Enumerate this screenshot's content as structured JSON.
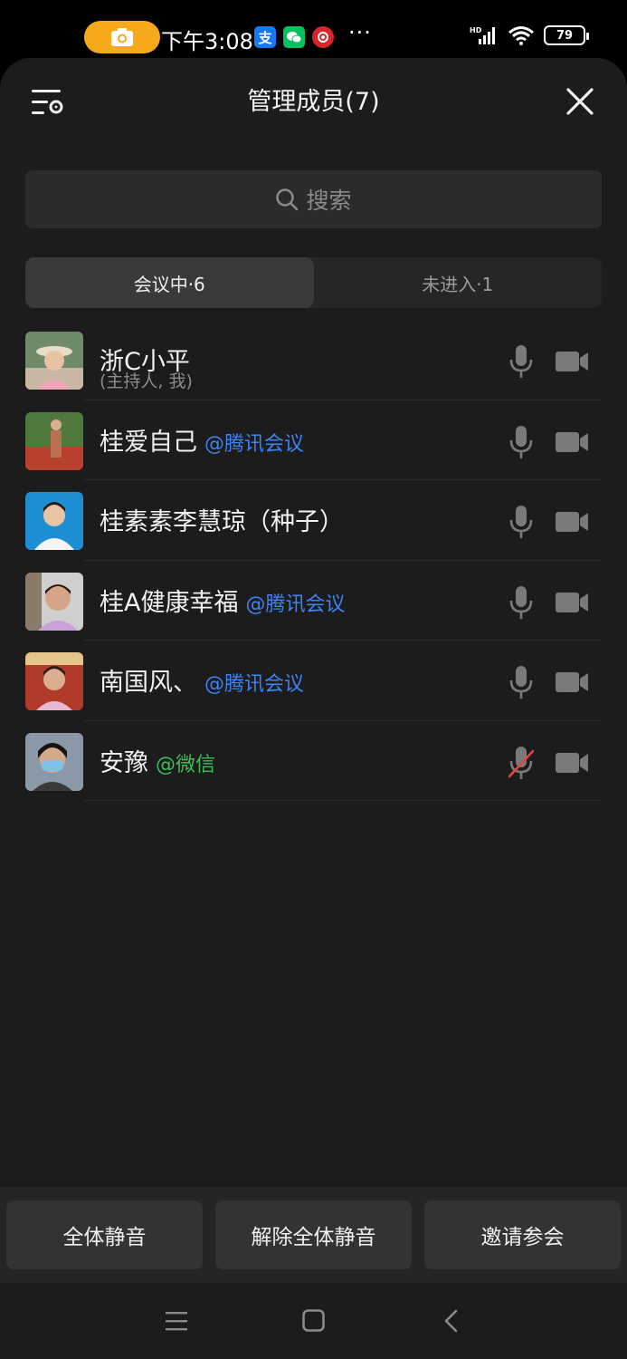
{
  "status_bar": {
    "time": "下午3:08",
    "battery": "79",
    "apps": [
      "alipay-icon",
      "wechat-icon",
      "red-app-icon"
    ]
  },
  "header": {
    "title": "管理成员(7)"
  },
  "search": {
    "placeholder": "搜索"
  },
  "tabs": [
    {
      "label": "会议中·6",
      "active": true
    },
    {
      "label": "未进入·1",
      "active": false
    }
  ],
  "members": [
    {
      "name": "浙C小平",
      "tag": "",
      "subtitle": "(主持人, 我)",
      "mic": "on",
      "camera": "off"
    },
    {
      "name": "桂爱自己",
      "tag": "@腾讯会议",
      "tag_color": "#3f82f4",
      "mic": "on",
      "camera": "off"
    },
    {
      "name": "桂素素李慧琼（种子）",
      "tag": "",
      "mic": "on",
      "camera": "off"
    },
    {
      "name": "桂A健康幸福",
      "tag": "@腾讯会议",
      "tag_color": "#3f82f4",
      "mic": "on",
      "camera": "off"
    },
    {
      "name": "南国风、",
      "tag": "@腾讯会议",
      "tag_color": "#3f82f4",
      "mic": "on",
      "camera": "off"
    },
    {
      "name": "安豫",
      "tag": "@微信",
      "tag_color": "#3fba5d",
      "mic": "muted",
      "camera": "off"
    }
  ],
  "actions": {
    "mute_all": "全体静音",
    "unmute_all": "解除全体静音",
    "invite": "邀请参会"
  },
  "colors": {
    "background": "#1c1c1c",
    "accent_blue": "#3f82f4",
    "accent_green": "#3fba5d",
    "muted_red": "#e0483c",
    "record_pill": "#f6a91b"
  }
}
